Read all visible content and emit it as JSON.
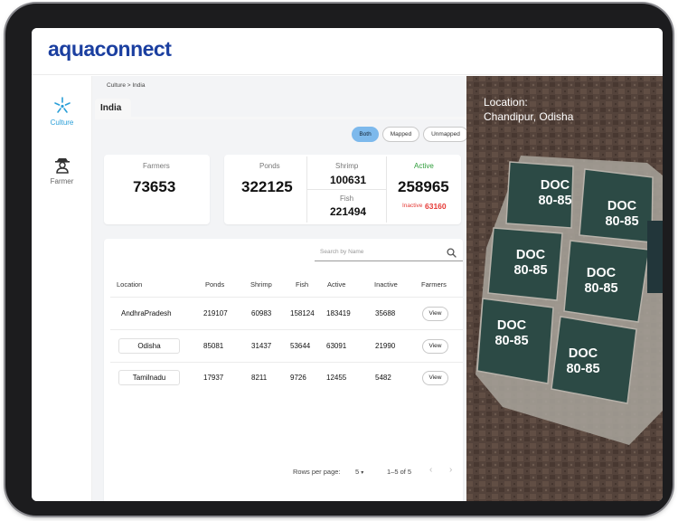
{
  "brand": {
    "logo": "aquaconnect"
  },
  "sidebar": {
    "items": [
      {
        "label": "Culture",
        "icon": "culture-icon",
        "active": true
      },
      {
        "label": "Farmer",
        "icon": "farmer-icon",
        "active": false
      }
    ]
  },
  "breadcrumb": "Culture > India",
  "region_tab": "India",
  "filters": {
    "options": [
      "Both",
      "Mapped",
      "Unmapped"
    ],
    "selected": "Both"
  },
  "stats": {
    "farmers_label": "Farmers",
    "farmers_value": "73653",
    "ponds_label": "Ponds",
    "ponds_value": "322125",
    "shrimp_label": "Shrimp",
    "shrimp_value": "100631",
    "fish_label": "Fish",
    "fish_value": "221494",
    "active_label": "Active",
    "active_value": "258965",
    "inactive_label": "Inactive",
    "inactive_value": "63160"
  },
  "search": {
    "placeholder": "Search by Name"
  },
  "table": {
    "columns": [
      "Location",
      "Ponds",
      "Shrimp",
      "Fish",
      "Active",
      "Inactive",
      "Farmers"
    ],
    "rows": [
      {
        "location": "AndhraPradesh",
        "ponds": "219107",
        "shrimp": "60983",
        "fish": "158124",
        "active": "183419",
        "inactive": "35688",
        "action": "View"
      },
      {
        "location": "Odisha",
        "ponds": "85081",
        "shrimp": "31437",
        "fish": "53644",
        "active": "63091",
        "inactive": "21990",
        "action": "View"
      },
      {
        "location": "Tamilnadu",
        "ponds": "17937",
        "shrimp": "8211",
        "fish": "9726",
        "active": "12455",
        "inactive": "5482",
        "action": "View"
      }
    ]
  },
  "pagination": {
    "rows_per_page_label": "Rows per page:",
    "rows_per_page": "5",
    "range": "1–5 of 5"
  },
  "satellite": {
    "location_label": "Location:",
    "location_value": "Chandipur, Odisha",
    "ponds": [
      "DOC 80-85",
      "DOC 80-85",
      "DOC 80-85",
      "DOC 80-85",
      "DOC 80-85",
      "DOC 80-85"
    ]
  },
  "colors": {
    "brand": "#1b3fa0",
    "accent": "#2a9fd8",
    "active_green": "#2e9d3a",
    "inactive_red": "#e53935",
    "filter_selected": "#7db9ec",
    "pond_water": "#2c4a45"
  }
}
